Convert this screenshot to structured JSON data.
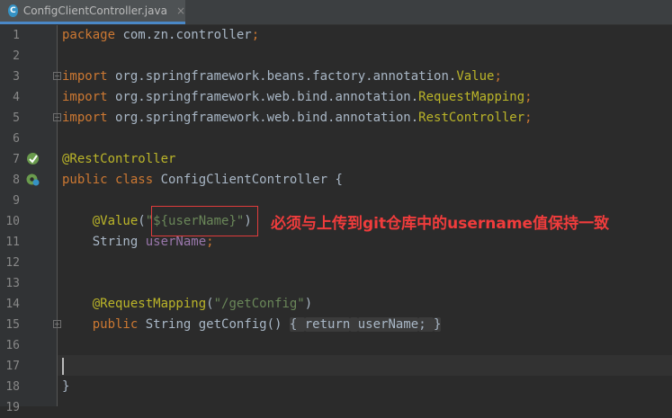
{
  "tab": {
    "filename": "ConfigClientController.java",
    "icon_letter": "C",
    "close_glyph": "×"
  },
  "lines": [
    {
      "n": "1",
      "tokens": [
        {
          "t": "package",
          "c": "kw"
        },
        {
          "t": " com.zn.controller",
          "c": ""
        },
        {
          "t": ";",
          "c": "kw"
        }
      ]
    },
    {
      "n": "2",
      "tokens": []
    },
    {
      "n": "3",
      "tokens": [
        {
          "t": "import",
          "c": "kw"
        },
        {
          "t": " org.springframework.beans.factory.annotation.",
          "c": ""
        },
        {
          "t": "Value",
          "c": "ann"
        },
        {
          "t": ";",
          "c": "kw"
        }
      ]
    },
    {
      "n": "4",
      "tokens": [
        {
          "t": "import",
          "c": "kw"
        },
        {
          "t": " org.springframework.web.bind.annotation.",
          "c": ""
        },
        {
          "t": "RequestMapping",
          "c": "ann"
        },
        {
          "t": ";",
          "c": "kw"
        }
      ]
    },
    {
      "n": "5",
      "tokens": [
        {
          "t": "import",
          "c": "kw"
        },
        {
          "t": " org.springframework.web.bind.annotation.",
          "c": ""
        },
        {
          "t": "RestController",
          "c": "ann"
        },
        {
          "t": ";",
          "c": "kw"
        }
      ]
    },
    {
      "n": "6",
      "tokens": []
    },
    {
      "n": "7",
      "tokens": [
        {
          "t": "@RestController",
          "c": "ann"
        }
      ]
    },
    {
      "n": "8",
      "tokens": [
        {
          "t": "public class",
          "c": "kw"
        },
        {
          "t": " ConfigClientController {",
          "c": ""
        }
      ]
    },
    {
      "n": "9",
      "tokens": []
    },
    {
      "n": "10",
      "tokens": [
        {
          "t": "    ",
          "c": ""
        },
        {
          "t": "@Value",
          "c": "ann"
        },
        {
          "t": "(",
          "c": ""
        },
        {
          "t": "\"${userName}\"",
          "c": "str"
        },
        {
          "t": ")",
          "c": ""
        }
      ]
    },
    {
      "n": "11",
      "tokens": [
        {
          "t": "    String ",
          "c": ""
        },
        {
          "t": "userName",
          "c": "fld"
        },
        {
          "t": ";",
          "c": "kw"
        }
      ]
    },
    {
      "n": "12",
      "tokens": []
    },
    {
      "n": "13",
      "tokens": []
    },
    {
      "n": "14",
      "tokens": [
        {
          "t": "    ",
          "c": ""
        },
        {
          "t": "@RequestMapping",
          "c": "ann"
        },
        {
          "t": "(",
          "c": ""
        },
        {
          "t": "\"/getConfig\"",
          "c": "str"
        },
        {
          "t": ")",
          "c": ""
        }
      ]
    },
    {
      "n": "15",
      "tokens": [
        {
          "t": "    ",
          "c": ""
        },
        {
          "t": "public",
          "c": "kw"
        },
        {
          "t": " String getConfig() ",
          "c": ""
        },
        {
          "t": "{ ",
          "c": "box"
        },
        {
          "t": "return",
          "c": "kwbox"
        },
        {
          "t": " ",
          "c": "box"
        },
        {
          "t": "userName",
          "c": "fldbox"
        },
        {
          "t": "; ",
          "c": "kwbox"
        },
        {
          "t": "}",
          "c": "box"
        }
      ]
    },
    {
      "n": "16",
      "tokens": []
    },
    {
      "n": "17",
      "tokens": []
    },
    {
      "n": "18",
      "tokens": [
        {
          "t": "}",
          "c": ""
        }
      ]
    },
    {
      "n": "19",
      "tokens": []
    }
  ],
  "annotation_note": "必须与上传到git仓库中的username值保持一致",
  "colors": {
    "background": "#2b2b2b",
    "keyword": "#cc7832",
    "annotation": "#bbb529",
    "string": "#6a8759",
    "field": "#9876aa",
    "note": "#f03c3c"
  }
}
